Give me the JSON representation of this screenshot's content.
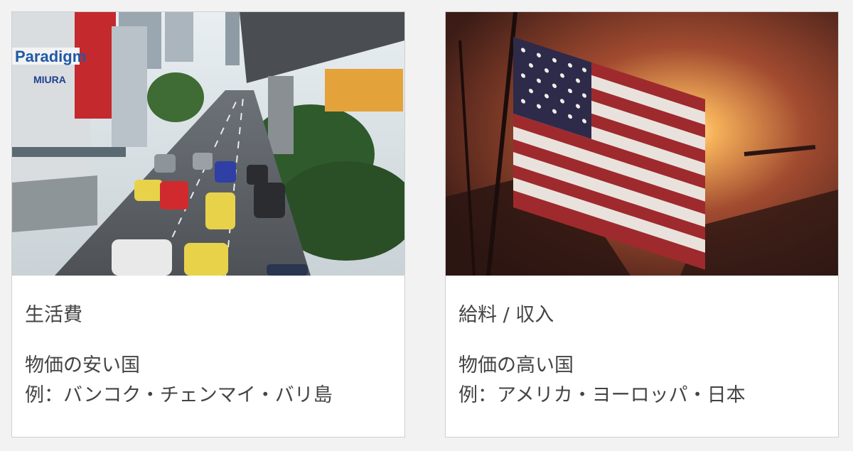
{
  "cards": [
    {
      "image": "bangkok-traffic-photo",
      "title": "生活費",
      "line1": "物価の安い国",
      "line2": "例：バンコク・チェンマイ・バリ島",
      "sign_paradigm": "Paradigm",
      "sign_miura": "MIURA"
    },
    {
      "image": "american-flag-sunset-photo",
      "title": "給料 / 収入",
      "line1": "物価の高い国",
      "line2": "例：アメリカ・ヨーロッパ・日本"
    }
  ]
}
